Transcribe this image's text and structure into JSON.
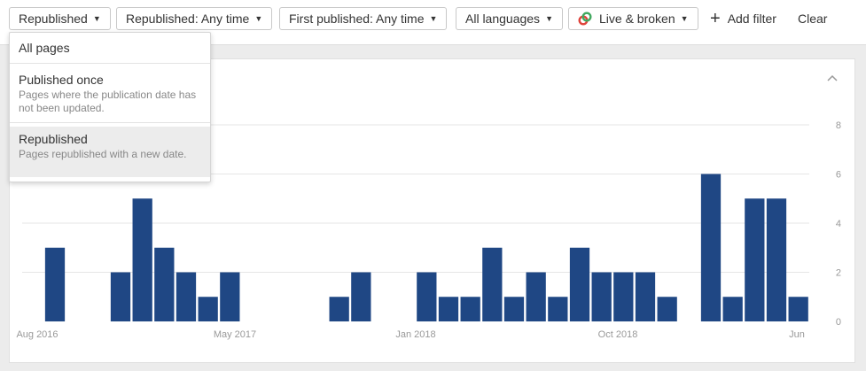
{
  "filters": {
    "republished": "Republished",
    "republished_time": "Republished: Any time",
    "first_published": "First published: Any time",
    "languages": "All languages",
    "status": "Live & broken",
    "add_filter": "Add filter",
    "clear": "Clear"
  },
  "dropdown": {
    "items": [
      {
        "title": "All pages",
        "desc": ""
      },
      {
        "title": "Published once",
        "desc": "Pages where the publication date has not been updated."
      },
      {
        "title": "Republished",
        "desc": "Pages republished with a new date."
      }
    ],
    "selected_index": 2
  },
  "colors": {
    "bar": "#1f4784",
    "grid": "#e6e6e6",
    "status_red": "#e0433b",
    "status_green": "#41a85f"
  },
  "icons": {
    "caret": "caret-down-icon",
    "plus": "plus-icon",
    "status": "live-broken-icon",
    "collapse": "chevron-up-icon"
  },
  "chart_data": {
    "type": "bar",
    "x_ticks": [
      "Aug 2016",
      "May 2017",
      "Jan 2018",
      "Oct 2018",
      "Jun"
    ],
    "y_ticks": [
      "0",
      "2",
      "4",
      "6",
      "8"
    ],
    "ylim": [
      0,
      8
    ],
    "grid": true,
    "values": [
      0,
      3,
      0,
      0,
      2,
      5,
      3,
      2,
      1,
      2,
      0,
      0,
      0,
      0,
      1,
      2,
      0,
      0,
      2,
      1,
      1,
      3,
      1,
      2,
      1,
      3,
      2,
      2,
      2,
      1,
      0,
      6,
      1,
      5,
      5,
      1
    ]
  }
}
